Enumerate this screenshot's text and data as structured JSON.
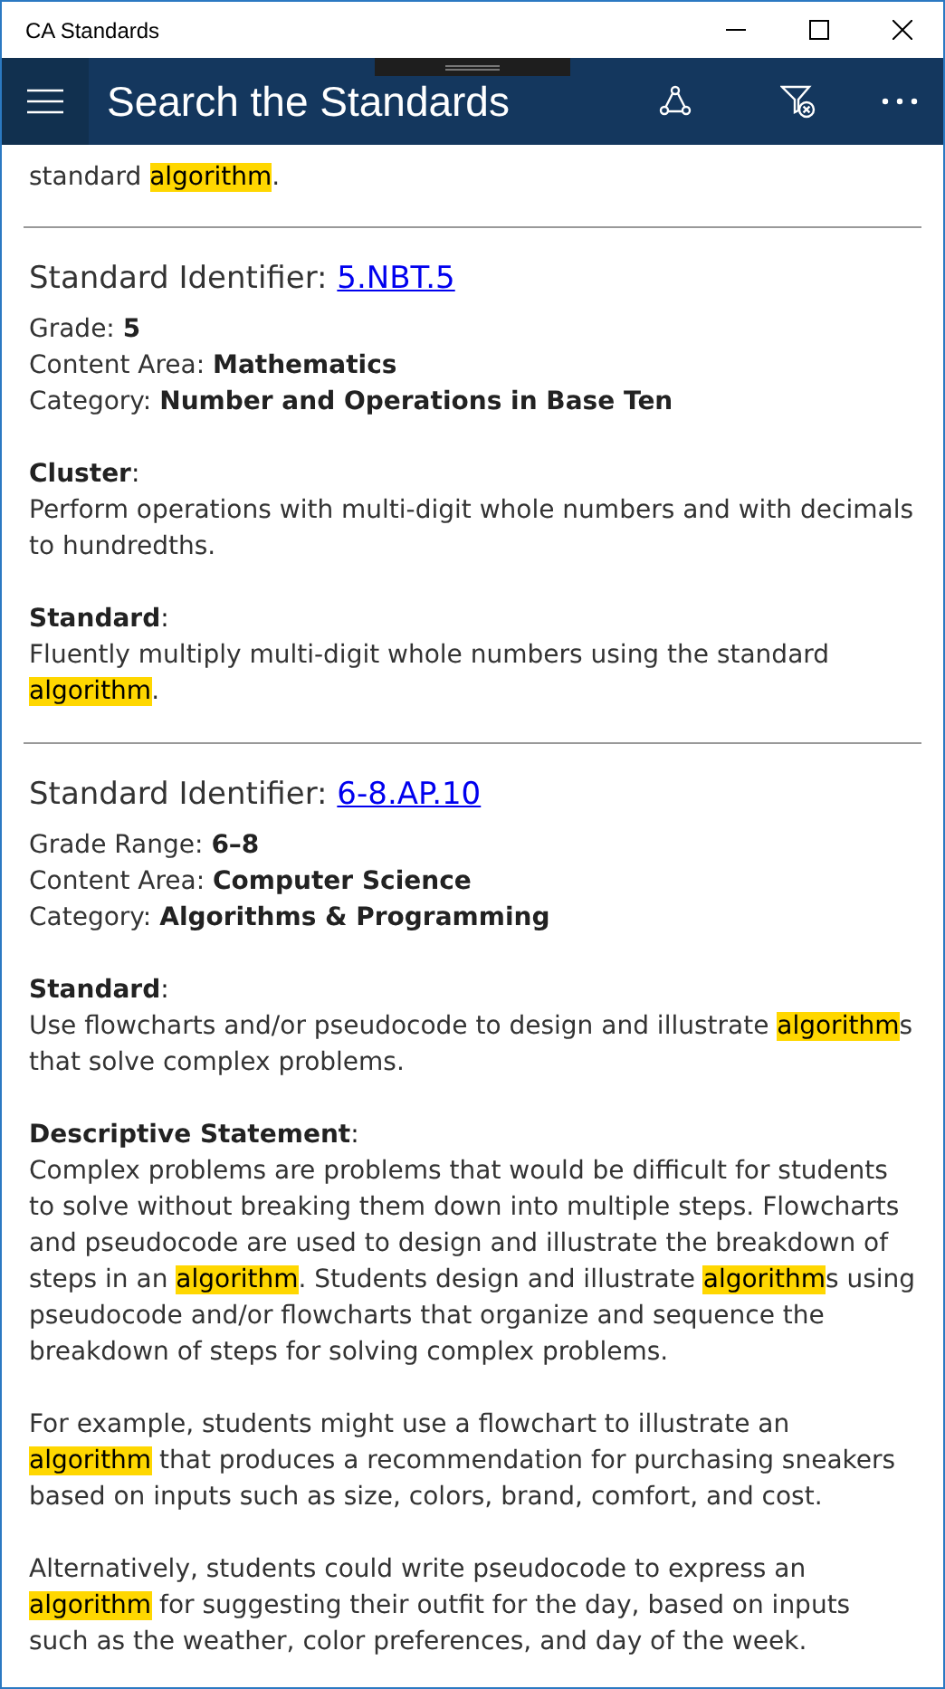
{
  "window": {
    "title": "CA Standards"
  },
  "header": {
    "title": "Search the Standards"
  },
  "top_fragment": [
    {
      "text": "standard ",
      "highlighted": false
    },
    {
      "text": "algorithm",
      "highlighted": true
    },
    {
      "text": ".",
      "highlighted": false
    }
  ],
  "entries": [
    {
      "identifier_label": "Standard Identifier: ",
      "identifier": "5.NBT.5",
      "meta": [
        {
          "label": "Grade: ",
          "value": "5"
        },
        {
          "label": "Content Area: ",
          "value": "Mathematics"
        },
        {
          "label": "Category: ",
          "value": "Number and Operations in Base Ten"
        }
      ],
      "sections": [
        {
          "heading": "**Cluster**:",
          "paragraphs": [
            [
              {
                "text": "Perform operations with multi-digit whole numbers and with decimals to hundredths.",
                "highlighted": false
              }
            ]
          ]
        },
        {
          "heading": "**Standard**:",
          "paragraphs": [
            [
              {
                "text": "Fluently multiply multi-digit whole numbers using the standard ",
                "highlighted": false
              },
              {
                "text": "algorithm",
                "highlighted": true
              },
              {
                "text": ".",
                "highlighted": false
              }
            ]
          ]
        }
      ]
    },
    {
      "identifier_label": "Standard Identifier: ",
      "identifier": "6-8.AP.10",
      "meta": [
        {
          "label": "Grade Range: ",
          "value": "6–8"
        },
        {
          "label": "Content Area: ",
          "value": "Computer Science"
        },
        {
          "label": "Category: ",
          "value": "Algorithms & Programming"
        }
      ],
      "sections": [
        {
          "heading": "**Standard**:",
          "paragraphs": [
            [
              {
                "text": "Use flowcharts and/or pseudocode to design and illustrate ",
                "highlighted": false
              },
              {
                "text": "algorithm",
                "highlighted": true
              },
              {
                "text": "s that solve complex problems.",
                "highlighted": false
              }
            ]
          ]
        },
        {
          "heading": "**Descriptive Statement**:",
          "paragraphs": [
            [
              {
                "text": "Complex problems are problems that would be difficult for students to solve without breaking them down into multiple steps. Flowcharts and pseudocode are used to design and illustrate the breakdown of steps in an ",
                "highlighted": false
              },
              {
                "text": "algorithm",
                "highlighted": true
              },
              {
                "text": ". Students design and illustrate ",
                "highlighted": false
              },
              {
                "text": "algorithm",
                "highlighted": true
              },
              {
                "text": "s using pseudocode and/or flowcharts that organize and sequence the breakdown of steps for solving complex problems.",
                "highlighted": false
              }
            ],
            [
              {
                "text": "For example, students might use a flowchart to illustrate an ",
                "highlighted": false
              },
              {
                "text": "algorithm",
                "highlighted": true
              },
              {
                "text": " that produces a recommendation for purchasing sneakers based on inputs such as size, colors, brand, comfort, and cost.",
                "highlighted": false
              }
            ],
            [
              {
                "text": "Alternatively, students could write pseudocode to express an ",
                "highlighted": false
              },
              {
                "text": "algorithm",
                "highlighted": true
              },
              {
                "text": " for suggesting their outfit for the day, based on inputs such as the weather, color preferences, and day of the week.",
                "highlighted": false
              }
            ]
          ]
        }
      ]
    }
  ]
}
